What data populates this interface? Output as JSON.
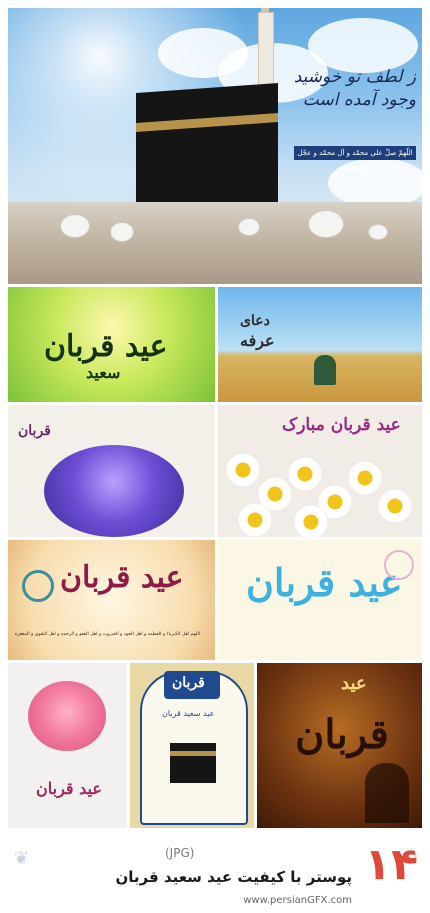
{
  "hero": {
    "calligraphy": "ز لطف تو خوشید وجود آمده است",
    "ribbon": "اللّهمّ صلّ علی محمّد و آل محمّد و عجّل فرجهم"
  },
  "tiles": {
    "t1": {
      "callig": "عید قربان",
      "sub": "سعید"
    },
    "t2": {
      "callig": "عرفه",
      "sub": "دعای"
    },
    "t3": {
      "callig": "قربان"
    },
    "t4": {
      "callig": "عید قربان مبارک"
    },
    "t5": {
      "callig": "عید قربان",
      "sub": "اللهم اهل الکبریاء و العظمه و اهل الجود و الجبروت و اهل العفو و الرحمه و اهل التقوی و المغفره"
    },
    "t6": {
      "callig": "عید قربان"
    },
    "t7": {
      "callig": "عید قربان"
    },
    "t8": {
      "callig": "قربان",
      "sub": "عید سعید قربان"
    },
    "t9": {
      "callig": "قربان",
      "sub": "عید"
    }
  },
  "footer": {
    "count": "۱۴",
    "format": "(JPG)",
    "title": "پوستر با کیفیت عید سعید قربان",
    "site": "www.persianGFX.com"
  },
  "colors": {
    "accent_red": "#e0483a",
    "text_dark": "#1a1a1a"
  }
}
